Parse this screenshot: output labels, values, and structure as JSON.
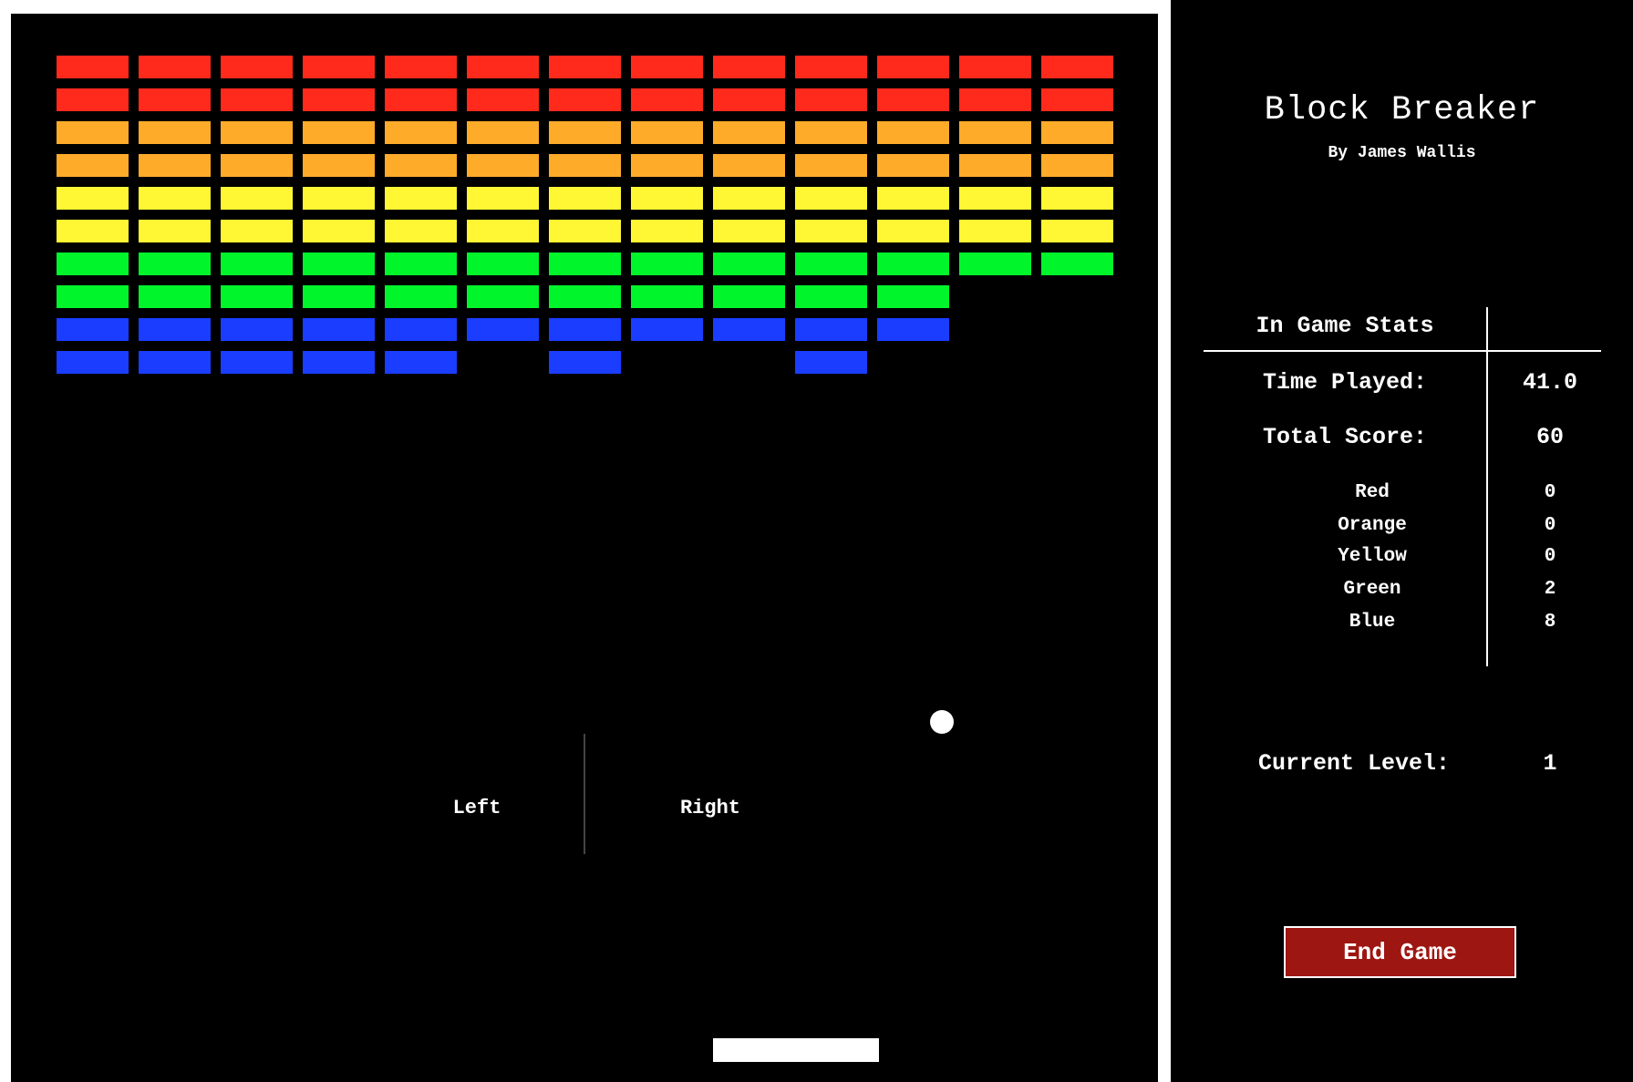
{
  "title": "Block Breaker",
  "author": "By James Wallis",
  "stats": {
    "heading": "In Game Stats",
    "time_played_label": "Time Played:",
    "time_played_value": "41.0",
    "total_score_label": "Total Score:",
    "total_score_value": "60",
    "colors": [
      {
        "label": "Red",
        "value": "0"
      },
      {
        "label": "Orange",
        "value": "0"
      },
      {
        "label": "Yellow",
        "value": "0"
      },
      {
        "label": "Green",
        "value": "2"
      },
      {
        "label": "Blue",
        "value": "8"
      }
    ],
    "level_label": "Current Level:",
    "level_value": "1"
  },
  "end_game_label": "End Game",
  "controls": {
    "left": "Left",
    "right": "Right"
  },
  "colors_hex": {
    "red": "#ff2a1c",
    "orange": "#ffab2a",
    "yellow": "#fff734",
    "green": "#00f52a",
    "blue": "#1a3dff",
    "end_button": "#9e1612"
  },
  "bricks": {
    "columns": 13,
    "rows": [
      {
        "color": "red",
        "present": [
          1,
          1,
          1,
          1,
          1,
          1,
          1,
          1,
          1,
          1,
          1,
          1,
          1
        ]
      },
      {
        "color": "red",
        "present": [
          1,
          1,
          1,
          1,
          1,
          1,
          1,
          1,
          1,
          1,
          1,
          1,
          1
        ]
      },
      {
        "color": "orange",
        "present": [
          1,
          1,
          1,
          1,
          1,
          1,
          1,
          1,
          1,
          1,
          1,
          1,
          1
        ]
      },
      {
        "color": "orange",
        "present": [
          1,
          1,
          1,
          1,
          1,
          1,
          1,
          1,
          1,
          1,
          1,
          1,
          1
        ]
      },
      {
        "color": "yellow",
        "present": [
          1,
          1,
          1,
          1,
          1,
          1,
          1,
          1,
          1,
          1,
          1,
          1,
          1
        ]
      },
      {
        "color": "yellow",
        "present": [
          1,
          1,
          1,
          1,
          1,
          1,
          1,
          1,
          1,
          1,
          1,
          1,
          1
        ]
      },
      {
        "color": "green",
        "present": [
          1,
          1,
          1,
          1,
          1,
          1,
          1,
          1,
          1,
          1,
          1,
          1,
          1
        ]
      },
      {
        "color": "green",
        "present": [
          1,
          1,
          1,
          1,
          1,
          1,
          1,
          1,
          1,
          1,
          1,
          0,
          0
        ]
      },
      {
        "color": "blue",
        "present": [
          1,
          1,
          1,
          1,
          1,
          1,
          1,
          1,
          1,
          1,
          1,
          0,
          0
        ]
      },
      {
        "color": "blue",
        "present": [
          1,
          1,
          1,
          1,
          1,
          0,
          1,
          0,
          0,
          1,
          0,
          0,
          0
        ]
      }
    ]
  }
}
